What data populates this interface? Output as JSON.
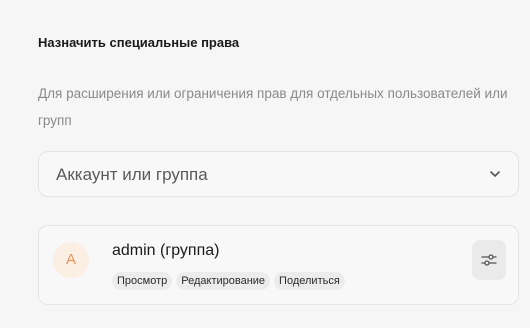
{
  "section": {
    "title": "Назначить специальные права",
    "description": "Для расширения или ограничения прав для отдельных пользователей или групп"
  },
  "account_select": {
    "placeholder": "Аккаунт или группа",
    "icon": "chevron-down-icon"
  },
  "entries": [
    {
      "avatar_letter": "A",
      "name": "admin (группа)",
      "permissions": [
        "Просмотр",
        "Редактирование",
        "Поделиться"
      ],
      "settings_icon": "sliders-icon"
    }
  ],
  "colors": {
    "avatar_bg": "#fbeee3",
    "avatar_fg": "#e3955c",
    "badge_bg": "#ececec"
  }
}
